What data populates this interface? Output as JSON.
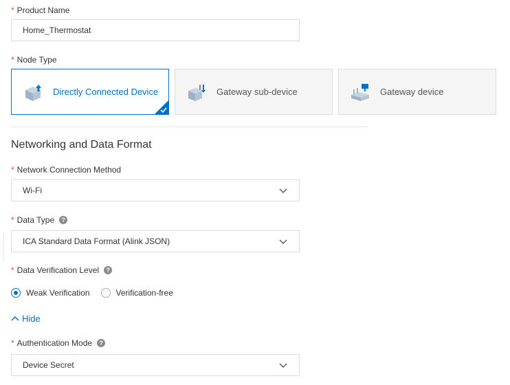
{
  "product_name": {
    "label": "Product Name",
    "required_mark": "*",
    "value": "Home_Thermostat"
  },
  "node_type": {
    "label": "Node Type",
    "required_mark": "*",
    "options": [
      {
        "label": "Directly Connected Device",
        "icon": "direct-device-icon",
        "selected": true
      },
      {
        "label": "Gateway sub-device",
        "icon": "sub-device-icon",
        "selected": false
      },
      {
        "label": "Gateway device",
        "icon": "gateway-icon",
        "selected": false
      }
    ]
  },
  "section": {
    "title": "Networking and Data Format"
  },
  "network_method": {
    "label": "Network Connection Method",
    "required_mark": "*",
    "value": "Wi-Fi"
  },
  "data_type": {
    "label": "Data Type",
    "required_mark": "*",
    "value": "ICA Standard Data Format (Alink JSON)",
    "help": "?"
  },
  "verification": {
    "label": "Data Verification Level",
    "required_mark": "*",
    "help": "?",
    "options": [
      {
        "label": "Weak Verification",
        "checked": true
      },
      {
        "label": "Verification-free",
        "checked": false
      }
    ]
  },
  "toggle": {
    "label": "Hide"
  },
  "auth_mode": {
    "label": "Authentication Mode",
    "required_mark": "*",
    "value": "Device Secret",
    "help": "?"
  },
  "colors": {
    "primary": "#0070cc",
    "required": "#e64c3c",
    "border": "#dcdcdc",
    "card_bg": "#f5f5f5"
  }
}
